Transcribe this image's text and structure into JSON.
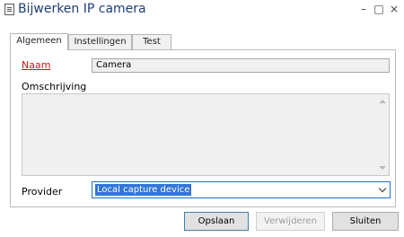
{
  "window": {
    "title": "Bijwerken IP camera",
    "minimize_glyph": "–",
    "maximize_glyph": "□",
    "close_glyph": "×"
  },
  "tabs": [
    {
      "label": "Algemeen",
      "active": true
    },
    {
      "label": "Instellingen",
      "active": false
    },
    {
      "label": "Test",
      "active": false
    }
  ],
  "form": {
    "name_label": "Naam",
    "name_value": "Camera",
    "description_label": "Omschrijving",
    "description_value": "",
    "provider_label": "Provider",
    "provider_value": "Local capture device"
  },
  "buttons": {
    "save": "Opslaan",
    "delete": "Verwijderen",
    "close": "Sluiten"
  },
  "colors": {
    "title": "#1e3c78",
    "required_label": "#d01616",
    "selection": "#3275d6",
    "focus_border": "#1e6fc8"
  }
}
